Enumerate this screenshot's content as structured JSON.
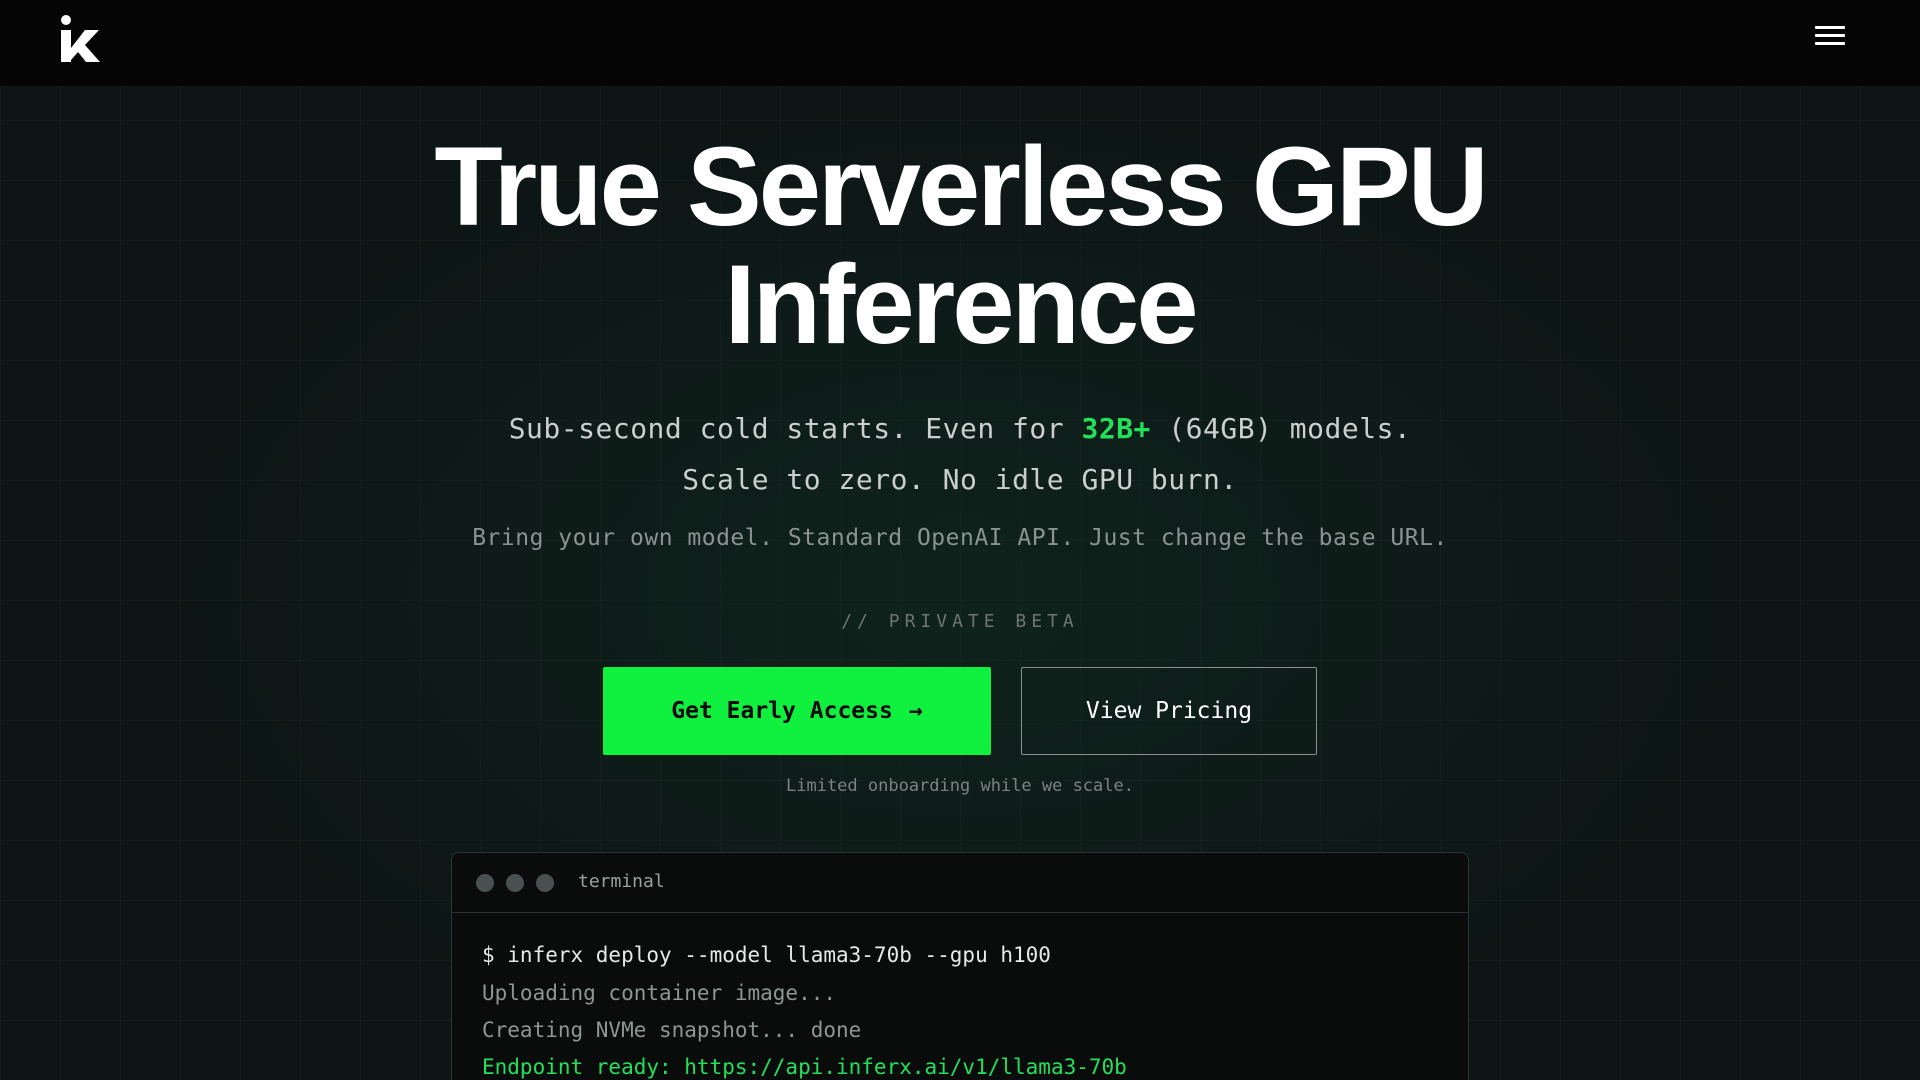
{
  "header": {
    "logo_icon": "ix-logo",
    "menu_icon": "hamburger-menu-icon"
  },
  "hero": {
    "title_line_1": "True Serverless GPU",
    "title_line_2": "Inference",
    "sub_1_prefix": "Sub-second cold starts. Even for ",
    "sub_1_accent": "32B+",
    "sub_1_suffix": " (64GB) models.",
    "sub_2": "Scale to zero. No idle GPU burn.",
    "sub_3": "Bring your own model. Standard OpenAI API. Just change the base URL.",
    "beta_tag": "// PRIVATE BETA"
  },
  "actions": {
    "primary_label": "Get Early Access",
    "primary_arrow": "→",
    "secondary_label": "View Pricing",
    "note": "Limited onboarding while we scale."
  },
  "terminal": {
    "title": "terminal",
    "lines": [
      "$ inferx deploy --model llama3-70b --gpu h100",
      "Uploading container image...",
      "Creating NVMe snapshot... done",
      "Endpoint ready: https://api.inferx.ai/v1/llama3-70b"
    ]
  },
  "colors": {
    "accent_green": "#10f03e",
    "accent_text_green": "#22e05a",
    "background": "#0d1515",
    "header_bg": "#050505"
  }
}
